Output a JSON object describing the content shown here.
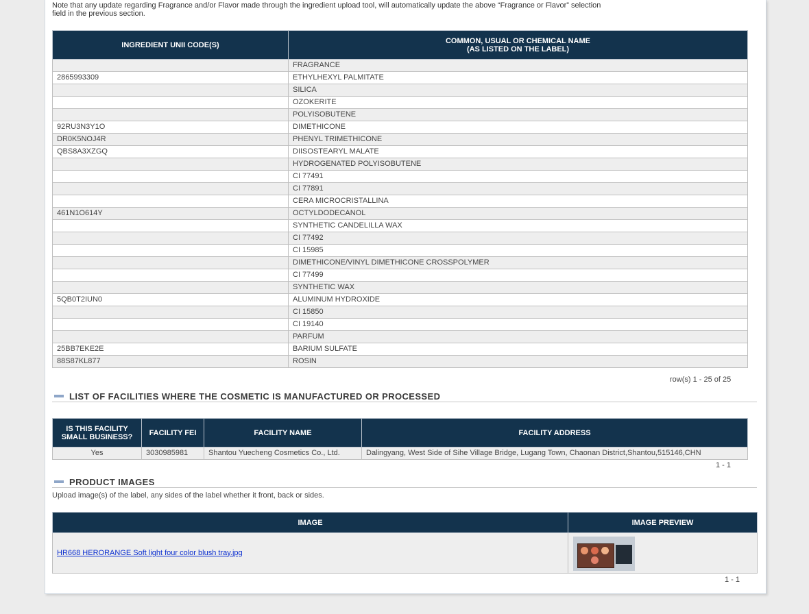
{
  "note": "Note that any update regarding Fragrance and/or Flavor made through the ingredient upload tool, will automatically update the above “Fragrance or Flavor” selection field in the previous section.",
  "ingredients": {
    "headers": {
      "code": "INGREDIENT UNII CODE(S)",
      "name_line1": "COMMON, USUAL OR CHEMICAL NAME",
      "name_line2": "(AS LISTED ON THE LABEL)"
    },
    "rows": [
      {
        "code": "",
        "name": "FRAGRANCE"
      },
      {
        "code": "2865993309",
        "name": "ETHYLHEXYL PALMITATE"
      },
      {
        "code": "",
        "name": "SILICA"
      },
      {
        "code": "",
        "name": "OZOKERITE"
      },
      {
        "code": "",
        "name": "POLYISOBUTENE"
      },
      {
        "code": "92RU3N3Y1O",
        "name": "DIMETHICONE"
      },
      {
        "code": "DR0K5NOJ4R",
        "name": "PHENYL TRIMETHICONE"
      },
      {
        "code": "QBS8A3XZGQ",
        "name": "DIISOSTEARYL MALATE"
      },
      {
        "code": "",
        "name": "HYDROGENATED POLYISOBUTENE"
      },
      {
        "code": "",
        "name": "CI 77491"
      },
      {
        "code": "",
        "name": "CI 77891"
      },
      {
        "code": "",
        "name": "CERA MICROCRISTALLINA"
      },
      {
        "code": "461N1O614Y",
        "name": "OCTYLDODECANOL"
      },
      {
        "code": "",
        "name": "SYNTHETIC CANDELILLA WAX"
      },
      {
        "code": "",
        "name": "CI 77492"
      },
      {
        "code": "",
        "name": "CI 15985"
      },
      {
        "code": "",
        "name": "DIMETHICONE/VINYL DIMETHICONE CROSSPOLYMER"
      },
      {
        "code": "",
        "name": "CI 77499"
      },
      {
        "code": "",
        "name": "SYNTHETIC WAX"
      },
      {
        "code": "5QB0T2IUN0",
        "name": "ALUMINUM HYDROXIDE"
      },
      {
        "code": "",
        "name": "CI 15850"
      },
      {
        "code": "",
        "name": "CI 19140"
      },
      {
        "code": "",
        "name": "PARFUM"
      },
      {
        "code": "25BB7EKE2E",
        "name": "BARIUM SULFATE"
      },
      {
        "code": "88S87KL877",
        "name": "ROSIN"
      }
    ],
    "row_count": "row(s) 1 - 25 of 25"
  },
  "facilities": {
    "title": "LIST OF FACILITIES WHERE THE COSMETIC IS MANUFACTURED OR PROCESSED",
    "headers": {
      "small_business_line1": "IS THIS FACILITY",
      "small_business_line2": "SMALL BUSINESS?",
      "fei": "FACILITY FEI",
      "name": "FACILITY NAME",
      "address": "FACILITY ADDRESS"
    },
    "rows": [
      {
        "small_business": "Yes",
        "fei": "3030985981",
        "name": "Shantou Yuecheng Cosmetics Co., Ltd.",
        "address": "Dalingyang, West Side of Sihe Village Bridge, Lugang Town, Chaonan District,Shantou,515146,CHN"
      }
    ],
    "pagination": "1 - 1"
  },
  "product_images": {
    "title": "PRODUCT IMAGES",
    "note": "Upload image(s) of the label, any sides of the label whether it front, back or sides.",
    "headers": {
      "image": "IMAGE",
      "preview": "IMAGE PREVIEW"
    },
    "rows": [
      {
        "file_name": "HR668 HERORANGE Soft light four color blush tray.jpg",
        "preview_icon": "blush-palette-thumbnail"
      }
    ],
    "pagination": "1 - 1"
  },
  "colors": {
    "header_bg": "#13334d",
    "link": "#0a2ed0",
    "stripe": "#eeeeee"
  }
}
